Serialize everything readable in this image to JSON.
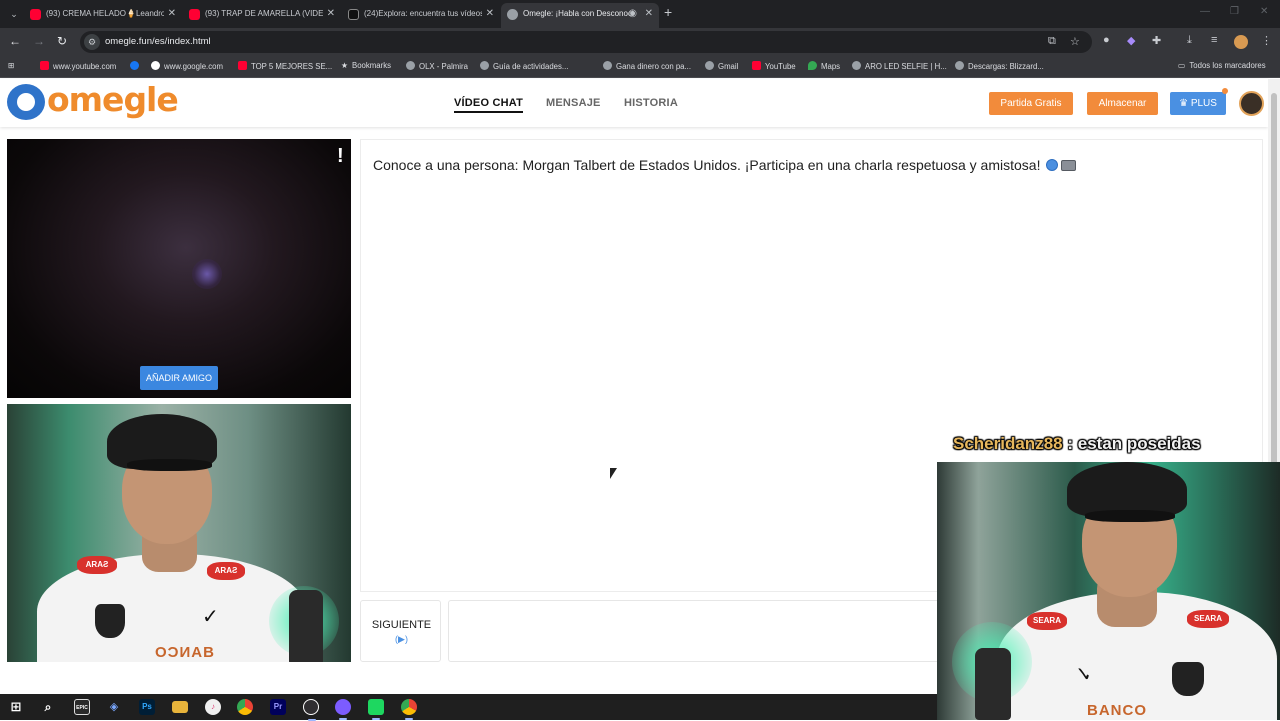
{
  "browser": {
    "tabs": [
      {
        "label": "(93) CREMA HELADO🍦Leandro",
        "favicon_color": "#ff0033",
        "active": false
      },
      {
        "label": "(93) TRAP DE AMARELLA (VIDEO",
        "favicon_color": "#ff0033",
        "active": false
      },
      {
        "label": "(24)Explora: encuentra tus vídeos",
        "favicon_color": "#111111",
        "active": false
      },
      {
        "label": "Omegle: ¡Habla con Desconocidos!",
        "favicon_color": "#9aa0a6",
        "active": true
      }
    ],
    "url": "omegle.fun/es/index.html",
    "bookmarks": [
      {
        "label": "www.youtube.com",
        "color": "#ff0033"
      },
      {
        "label": "",
        "color": "#1877f2"
      },
      {
        "label": "www.google.com",
        "color": "#8ab4f8"
      },
      {
        "label": "TOP 5 MEJORES SE...",
        "color": "#ff0033"
      },
      {
        "label": "Bookmarks",
        "color": "#c8cbd0"
      },
      {
        "label": "OLX - Palmira",
        "color": "#9aa0a6"
      },
      {
        "label": "Guía de actividades...",
        "color": "#9aa0a6"
      },
      {
        "label": "Gana dinero con pa...",
        "color": "#9aa0a6"
      },
      {
        "label": "Gmail",
        "color": "#9aa0a6"
      },
      {
        "label": "YouTube",
        "color": "#ff0033"
      },
      {
        "label": "Maps",
        "color": "#34a853"
      },
      {
        "label": "ARO LED SELFIE | H...",
        "color": "#9aa0a6"
      },
      {
        "label": "Descargas: Blizzard...",
        "color": "#9aa0a6"
      }
    ],
    "all_bookmarks": "Todos los marcadores"
  },
  "site": {
    "logo": "omegle",
    "nav": {
      "video_chat": "VÍDEO CHAT",
      "message": "MENSAJE",
      "history": "HISTORIA"
    },
    "buttons": {
      "free_match": "Partida Gratis",
      "store": "Almacenar",
      "plus": "PLUS"
    },
    "add_friend": "AÑADIR AMIGO",
    "report": "!",
    "chat_message": "Conoce a una persona: Morgan Talbert de Estados Unidos. ¡Participa en una charla respetuosa y amistosa!",
    "next_button": "SIGUIENTE",
    "next_hint": "(▶)",
    "colors": {
      "accent_orange": "#f28b3b",
      "accent_blue": "#4a90e2",
      "logo_blue": "#2f73c9",
      "logo_orange": "#ef8b2c"
    }
  },
  "stream_overlay": {
    "chat_user": "Scheridanz88",
    "chat_separator": ":",
    "chat_text": "estan poseidas"
  },
  "webcam": {
    "shirt_sponsor": "SEARA",
    "shirt_sponsor_mirrored": "ARAƧ",
    "bank_text": "BANCO",
    "bank_text_mirrored": "OƆИAB"
  },
  "taskbar": {
    "icons": [
      "windows-start-icon",
      "search-icon",
      "epic-games-icon",
      "vscode-icon",
      "photoshop-icon",
      "file-explorer-icon",
      "itunes-icon",
      "chrome-icon",
      "premiere-icon",
      "obs-icon",
      "twitch-app-icon",
      "spotify-icon",
      "chrome-profile-icon"
    ],
    "epic": "EPIC",
    "ps": "Ps",
    "pr": "Pr"
  }
}
